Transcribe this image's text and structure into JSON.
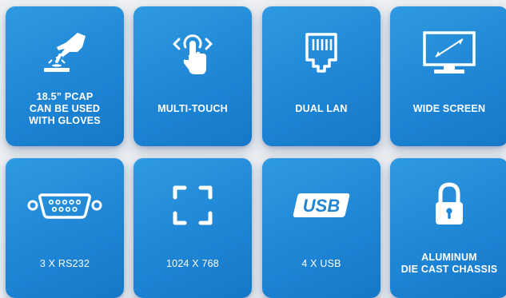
{
  "features": [
    {
      "label": "18.5” PCAP\nCAN BE USED\nWITH GLOVES",
      "icon": "glove-touch-icon"
    },
    {
      "label": "MULTI-TOUCH",
      "icon": "multi-touch-icon"
    },
    {
      "label": "DUAL LAN",
      "icon": "ethernet-port-icon"
    },
    {
      "label": "WIDE SCREEN",
      "icon": "widescreen-monitor-icon"
    },
    {
      "label": "3 X RS232",
      "icon": "serial-port-icon"
    },
    {
      "label": "1024 X 768",
      "icon": "resolution-frame-icon"
    },
    {
      "label": "4 X USB",
      "icon": "usb-icon"
    },
    {
      "label": "ALUMINUM\nDIE CAST CHASSIS",
      "icon": "padlock-icon"
    }
  ],
  "colors": {
    "tile": "#1f86d6",
    "text": "#ffffff",
    "background": "#eef0f3"
  },
  "usb_icon_text": "USB"
}
